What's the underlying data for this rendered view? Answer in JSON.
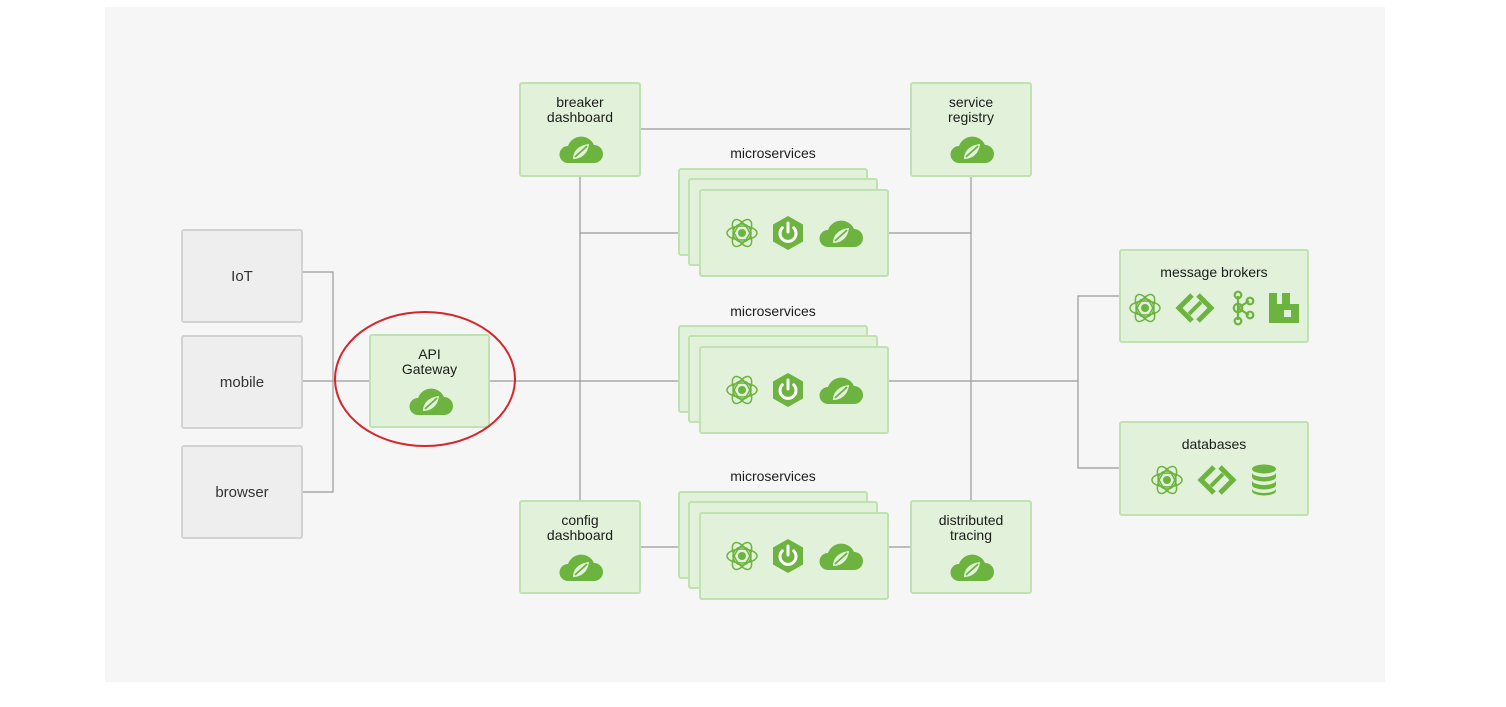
{
  "clients": [
    {
      "id": "iot",
      "label": "IoT"
    },
    {
      "id": "mobile",
      "label": "mobile"
    },
    {
      "id": "browser",
      "label": "browser"
    }
  ],
  "gateway": {
    "label": "API\nGateway"
  },
  "support_services": {
    "breaker_dashboard": "breaker\ndashboard",
    "service_registry": "service\nregistry",
    "config_dashboard": "config\ndashboard",
    "distributed_tracing": "distributed\ntracing"
  },
  "microservices": [
    {
      "title": "microservices",
      "icons": [
        "atom-icon",
        "spring-boot-icon",
        "spring-cloud-icon"
      ]
    },
    {
      "title": "microservices",
      "icons": [
        "atom-icon",
        "spring-boot-icon",
        "spring-cloud-icon"
      ]
    },
    {
      "title": "microservices",
      "icons": [
        "atom-icon",
        "spring-boot-icon",
        "spring-cloud-icon"
      ]
    }
  ],
  "backends": {
    "message_brokers": {
      "label": "message brokers",
      "icons": [
        "atom-icon",
        "spring-integration-icon",
        "kafka-icon",
        "rabbitmq-icon"
      ]
    },
    "databases": {
      "label": "databases",
      "icons": [
        "atom-icon",
        "spring-integration-icon",
        "database-icon"
      ]
    }
  },
  "colors": {
    "canvas": "#f6f6f6",
    "client_fill": "#eeeeee",
    "client_border": "#d2d2d2",
    "service_fill": "#e2f2da",
    "service_border": "#bfe2b1",
    "icon_green": "#6db33f",
    "connector": "#9a9a9a",
    "highlight_ring": "#d7252b"
  }
}
